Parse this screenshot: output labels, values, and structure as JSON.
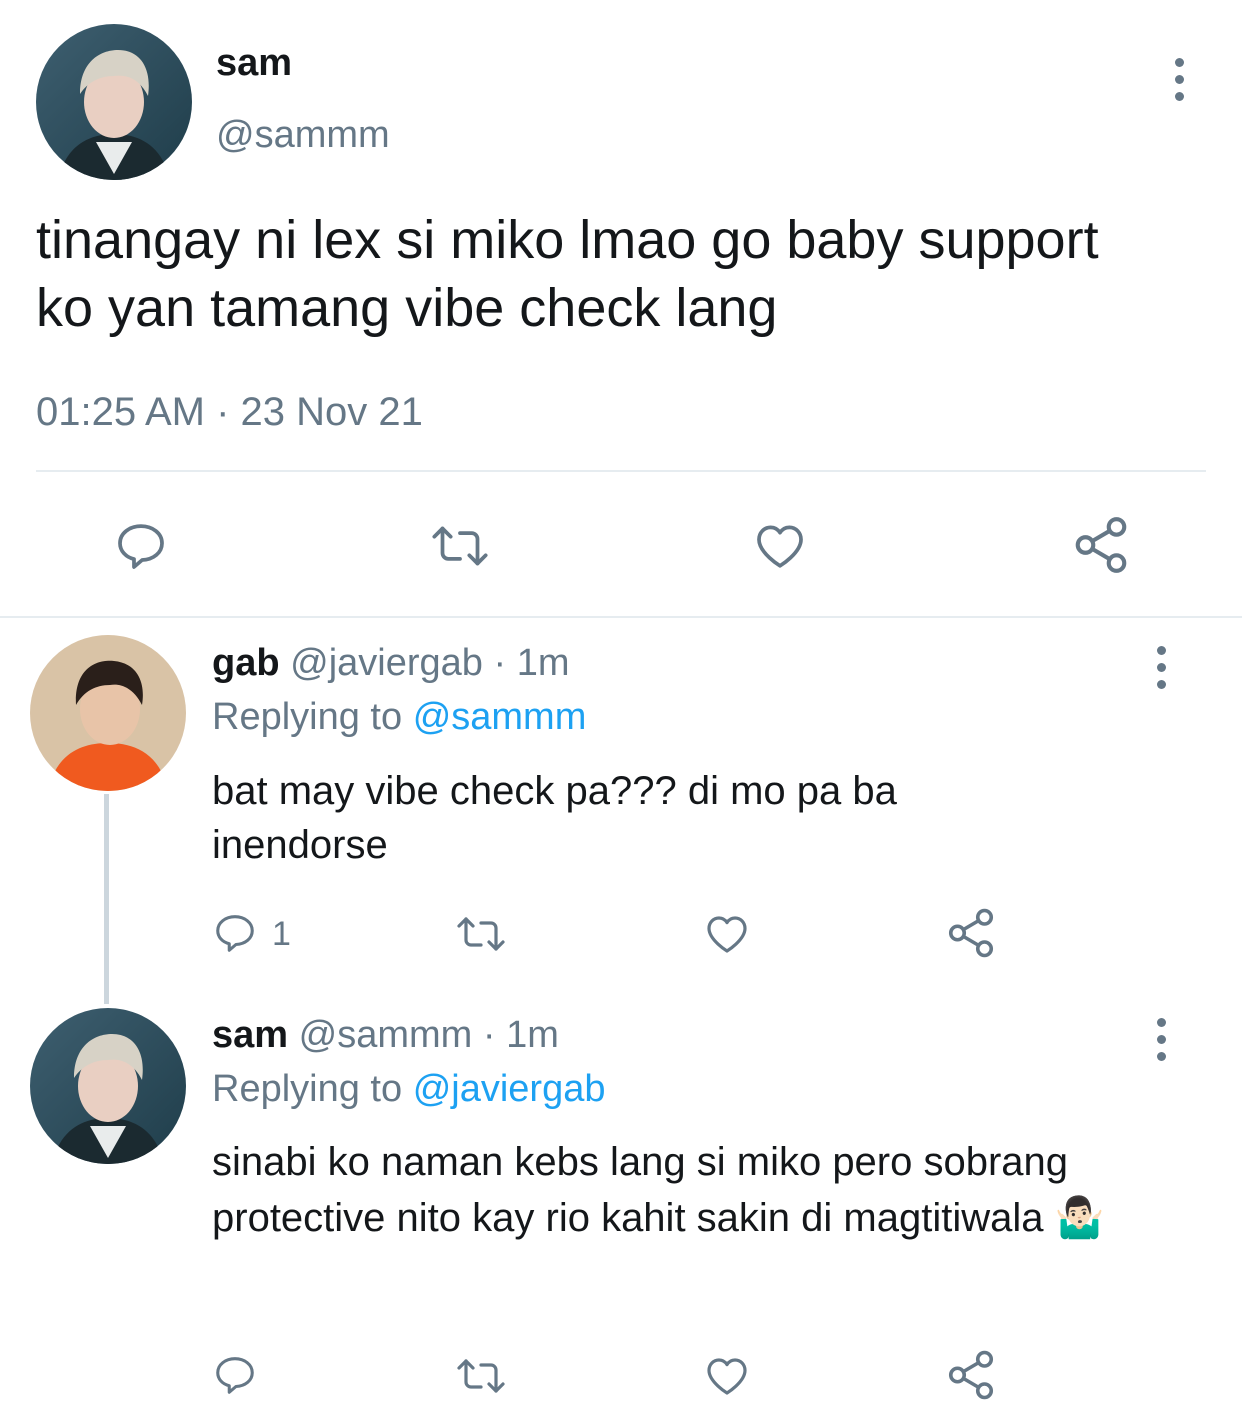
{
  "main_tweet": {
    "display_name": "sam",
    "handle": "@sammm",
    "text": "tinangay ni lex si miko lmao go baby support ko yan tamang vibe check lang",
    "timestamp": "01:25 AM · 23 Nov 21"
  },
  "replies": [
    {
      "display_name": "gab",
      "handle": "@javiergab",
      "time": "· 1m",
      "replying_prefix": "Replying to",
      "replying_to": "@sammm",
      "text": "bat may vibe check pa??? di mo pa ba inendorse",
      "reply_count": "1"
    },
    {
      "display_name": "sam",
      "handle": "@sammm",
      "time": "· 1m",
      "replying_prefix": "Replying to",
      "replying_to": "@javiergab",
      "text": "sinabi ko naman kebs lang si miko pero sobrang protective nito kay rio kahit sakin di magtitiwala",
      "emoji": "🤷🏻‍♂️"
    }
  ],
  "colors": {
    "text": "#14171a",
    "muted": "#657786",
    "link": "#1da1f2",
    "divider": "#e6ecf0"
  },
  "icons": [
    "more-icon",
    "reply-icon",
    "retweet-icon",
    "like-icon",
    "share-icon"
  ]
}
